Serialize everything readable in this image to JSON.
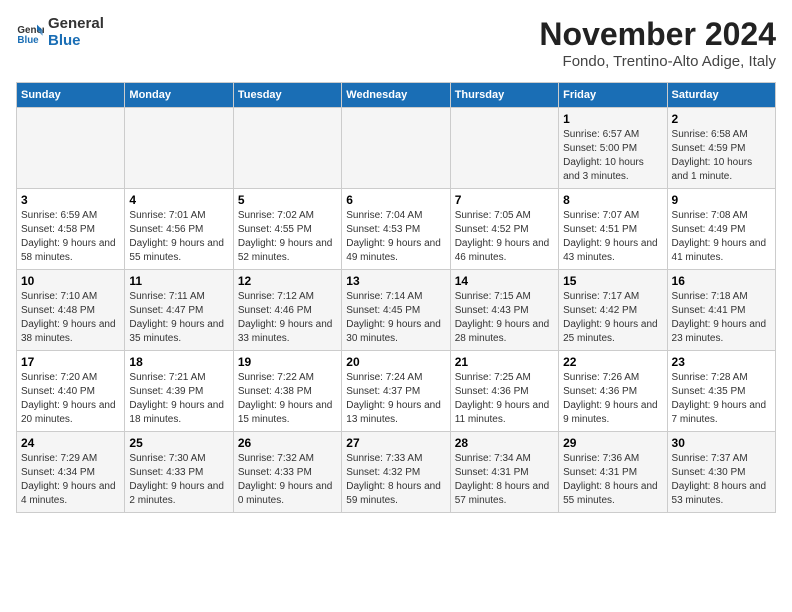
{
  "header": {
    "logo_line1": "General",
    "logo_line2": "Blue",
    "month_year": "November 2024",
    "location": "Fondo, Trentino-Alto Adige, Italy"
  },
  "days_of_week": [
    "Sunday",
    "Monday",
    "Tuesday",
    "Wednesday",
    "Thursday",
    "Friday",
    "Saturday"
  ],
  "weeks": [
    [
      {
        "day": "",
        "info": ""
      },
      {
        "day": "",
        "info": ""
      },
      {
        "day": "",
        "info": ""
      },
      {
        "day": "",
        "info": ""
      },
      {
        "day": "",
        "info": ""
      },
      {
        "day": "1",
        "info": "Sunrise: 6:57 AM\nSunset: 5:00 PM\nDaylight: 10 hours and 3 minutes."
      },
      {
        "day": "2",
        "info": "Sunrise: 6:58 AM\nSunset: 4:59 PM\nDaylight: 10 hours and 1 minute."
      }
    ],
    [
      {
        "day": "3",
        "info": "Sunrise: 6:59 AM\nSunset: 4:58 PM\nDaylight: 9 hours and 58 minutes."
      },
      {
        "day": "4",
        "info": "Sunrise: 7:01 AM\nSunset: 4:56 PM\nDaylight: 9 hours and 55 minutes."
      },
      {
        "day": "5",
        "info": "Sunrise: 7:02 AM\nSunset: 4:55 PM\nDaylight: 9 hours and 52 minutes."
      },
      {
        "day": "6",
        "info": "Sunrise: 7:04 AM\nSunset: 4:53 PM\nDaylight: 9 hours and 49 minutes."
      },
      {
        "day": "7",
        "info": "Sunrise: 7:05 AM\nSunset: 4:52 PM\nDaylight: 9 hours and 46 minutes."
      },
      {
        "day": "8",
        "info": "Sunrise: 7:07 AM\nSunset: 4:51 PM\nDaylight: 9 hours and 43 minutes."
      },
      {
        "day": "9",
        "info": "Sunrise: 7:08 AM\nSunset: 4:49 PM\nDaylight: 9 hours and 41 minutes."
      }
    ],
    [
      {
        "day": "10",
        "info": "Sunrise: 7:10 AM\nSunset: 4:48 PM\nDaylight: 9 hours and 38 minutes."
      },
      {
        "day": "11",
        "info": "Sunrise: 7:11 AM\nSunset: 4:47 PM\nDaylight: 9 hours and 35 minutes."
      },
      {
        "day": "12",
        "info": "Sunrise: 7:12 AM\nSunset: 4:46 PM\nDaylight: 9 hours and 33 minutes."
      },
      {
        "day": "13",
        "info": "Sunrise: 7:14 AM\nSunset: 4:45 PM\nDaylight: 9 hours and 30 minutes."
      },
      {
        "day": "14",
        "info": "Sunrise: 7:15 AM\nSunset: 4:43 PM\nDaylight: 9 hours and 28 minutes."
      },
      {
        "day": "15",
        "info": "Sunrise: 7:17 AM\nSunset: 4:42 PM\nDaylight: 9 hours and 25 minutes."
      },
      {
        "day": "16",
        "info": "Sunrise: 7:18 AM\nSunset: 4:41 PM\nDaylight: 9 hours and 23 minutes."
      }
    ],
    [
      {
        "day": "17",
        "info": "Sunrise: 7:20 AM\nSunset: 4:40 PM\nDaylight: 9 hours and 20 minutes."
      },
      {
        "day": "18",
        "info": "Sunrise: 7:21 AM\nSunset: 4:39 PM\nDaylight: 9 hours and 18 minutes."
      },
      {
        "day": "19",
        "info": "Sunrise: 7:22 AM\nSunset: 4:38 PM\nDaylight: 9 hours and 15 minutes."
      },
      {
        "day": "20",
        "info": "Sunrise: 7:24 AM\nSunset: 4:37 PM\nDaylight: 9 hours and 13 minutes."
      },
      {
        "day": "21",
        "info": "Sunrise: 7:25 AM\nSunset: 4:36 PM\nDaylight: 9 hours and 11 minutes."
      },
      {
        "day": "22",
        "info": "Sunrise: 7:26 AM\nSunset: 4:36 PM\nDaylight: 9 hours and 9 minutes."
      },
      {
        "day": "23",
        "info": "Sunrise: 7:28 AM\nSunset: 4:35 PM\nDaylight: 9 hours and 7 minutes."
      }
    ],
    [
      {
        "day": "24",
        "info": "Sunrise: 7:29 AM\nSunset: 4:34 PM\nDaylight: 9 hours and 4 minutes."
      },
      {
        "day": "25",
        "info": "Sunrise: 7:30 AM\nSunset: 4:33 PM\nDaylight: 9 hours and 2 minutes."
      },
      {
        "day": "26",
        "info": "Sunrise: 7:32 AM\nSunset: 4:33 PM\nDaylight: 9 hours and 0 minutes."
      },
      {
        "day": "27",
        "info": "Sunrise: 7:33 AM\nSunset: 4:32 PM\nDaylight: 8 hours and 59 minutes."
      },
      {
        "day": "28",
        "info": "Sunrise: 7:34 AM\nSunset: 4:31 PM\nDaylight: 8 hours and 57 minutes."
      },
      {
        "day": "29",
        "info": "Sunrise: 7:36 AM\nSunset: 4:31 PM\nDaylight: 8 hours and 55 minutes."
      },
      {
        "day": "30",
        "info": "Sunrise: 7:37 AM\nSunset: 4:30 PM\nDaylight: 8 hours and 53 minutes."
      }
    ]
  ]
}
